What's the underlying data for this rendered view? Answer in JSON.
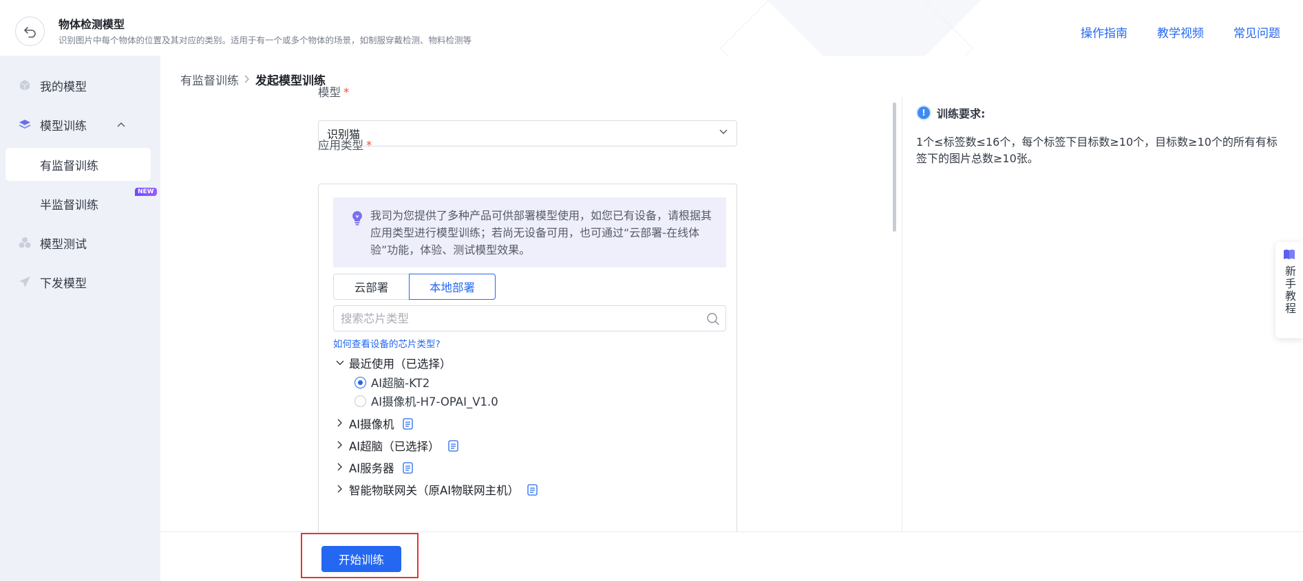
{
  "header": {
    "title": "物体检测模型",
    "subtitle": "识别图片中每个物体的位置及其对应的类别。适用于有一个或多个物体的场景，如制服穿戴检测、物料检测等",
    "links": [
      "操作指南",
      "教学视频",
      "常见问题"
    ]
  },
  "sidebar": {
    "items": [
      {
        "label": "我的模型",
        "icon": "cube-icon"
      },
      {
        "label": "模型训练",
        "icon": "layers-icon"
      },
      {
        "label": "有监督训练"
      },
      {
        "label": "半监督训练",
        "badge": "NEW"
      },
      {
        "label": "模型测试",
        "icon": "circles-icon"
      },
      {
        "label": "下发模型",
        "icon": "send-icon"
      }
    ]
  },
  "breadcrumb": {
    "parent": "有监督训练",
    "current": "发起模型训练"
  },
  "form": {
    "model_label": "模型",
    "required_mark": "*",
    "model_value": "识别猫",
    "app_type_label": "应用类型",
    "notice": "我司为您提供了多种产品可供部署模型使用，如您已有设备，请根据其应用类型进行模型训练；若尚无设备可用，也可通过“云部署-在线体验”功能，体验、测试模型效果。",
    "tabs": [
      "云部署",
      "本地部署"
    ],
    "active_tab": "本地部署",
    "search_placeholder": "搜索芯片类型",
    "help_link": "如何查看设备的芯片类型?",
    "recent_group": "最近使用（已选择）",
    "recent_options": [
      {
        "label": "AI超脑-KT2",
        "selected": true
      },
      {
        "label": "AI摄像机-H7-OPAI_V1.0",
        "selected": false
      }
    ],
    "groups": [
      "AI摄像机",
      "AI超脑（已选择）",
      "AI服务器",
      "智能物联网关（原AI物联网主机）"
    ]
  },
  "requirements": {
    "title": "训练要求:",
    "body": "1个≤标签数≤16个，每个标签下目标数≥10个，目标数≥10个的所有有标签下的图片总数≥10张。"
  },
  "footer": {
    "start_button": "开始训练"
  },
  "float": {
    "tutorial_label": "新手教程"
  }
}
